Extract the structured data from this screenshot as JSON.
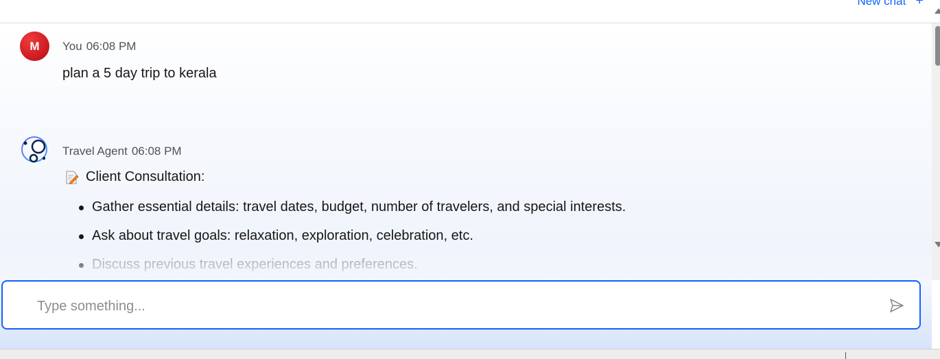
{
  "header": {
    "new_chat_label": "New chat",
    "new_chat_icon": "plus-icon"
  },
  "messages": [
    {
      "sender": "You",
      "time": "06:08 PM",
      "avatar_letter": "M",
      "text": "plan a 5 day trip to kerala"
    },
    {
      "sender": "Travel Agent",
      "time": "06:08 PM",
      "avatar_icon": "agent-logo-icon",
      "section_title": "Client Consultation:",
      "section_icon": "memo-icon",
      "points": [
        "Gather essential details: travel dates, budget, number of travelers, and special interests.",
        "Ask about travel goals: relaxation, exploration, celebration, etc.",
        "Discuss previous travel experiences and preferences."
      ]
    }
  ],
  "composer": {
    "placeholder": "Type something...",
    "value": "",
    "send_icon": "send-icon"
  },
  "colors": {
    "accent": "#0f62fe",
    "user_avatar": "#da1e28",
    "agent_logo": "#0b1f4d"
  }
}
